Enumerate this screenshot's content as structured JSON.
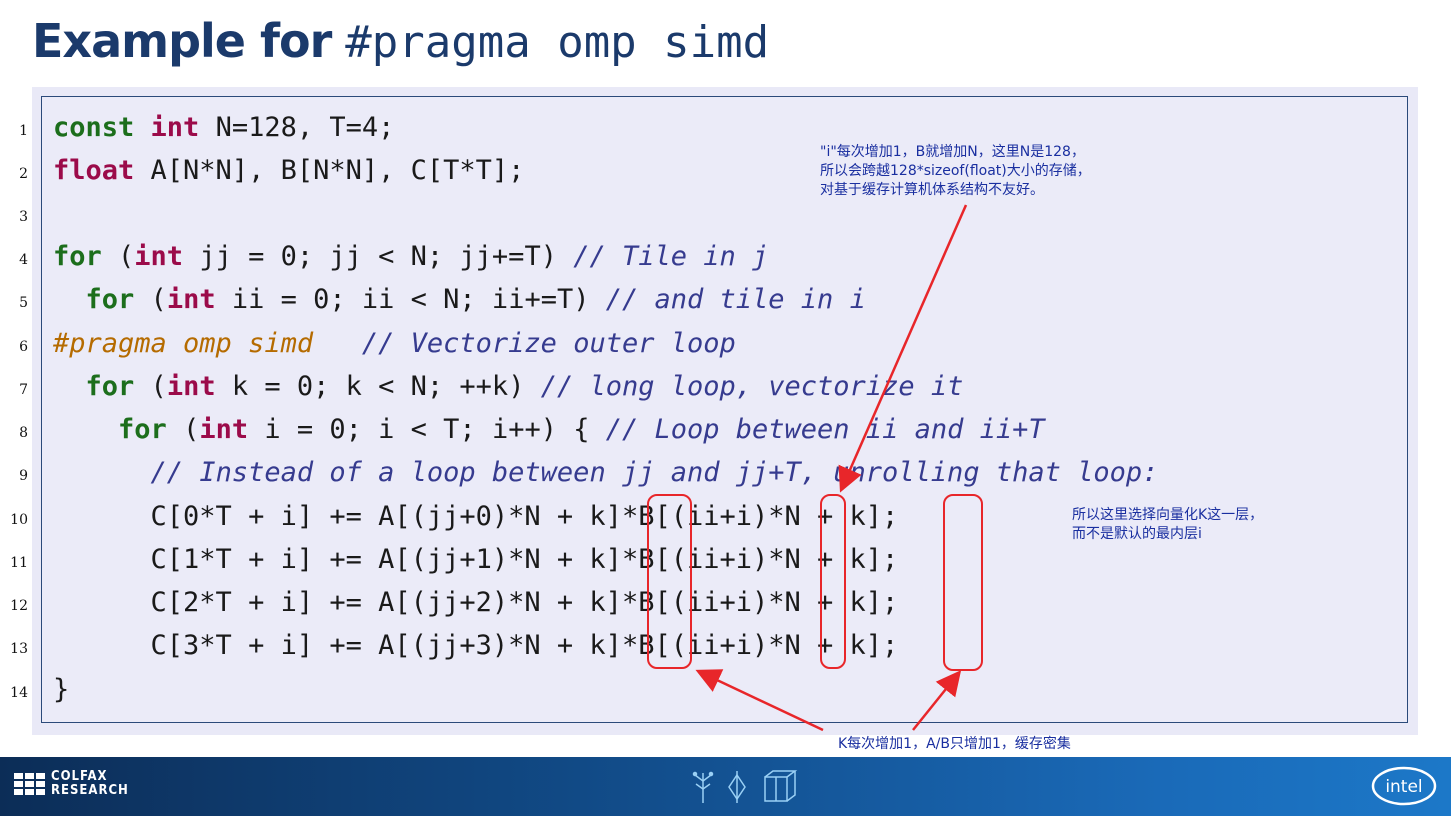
{
  "title": {
    "main": "Example for",
    "code": "#pragma omp simd"
  },
  "line_numbers": [
    "1",
    "2",
    "3",
    "4",
    "5",
    "6",
    "7",
    "8",
    "9",
    "10",
    "11",
    "12",
    "13",
    "14"
  ],
  "code": {
    "l1": {
      "kw_const": "const",
      "kw_int": "int",
      "rest": " N=128, T=4;"
    },
    "l2": {
      "kw_float": "float",
      "rest": " A[N*N], B[N*N], C[T*T];"
    },
    "l4": {
      "kw_for": "for",
      "p1": " (",
      "kw_int": "int",
      "p2": " jj = 0; jj < N; jj+=T) ",
      "comment": "// Tile in j"
    },
    "l5": {
      "indent": "  ",
      "kw_for": "for",
      "p1": " (",
      "kw_int": "int",
      "p2": " ii = 0; ii < N; ii+=T) ",
      "comment": "// and tile in i"
    },
    "l6": {
      "pragma": "#pragma omp simd",
      "gap": "   ",
      "comment": "// Vectorize outer loop"
    },
    "l7": {
      "indent": "  ",
      "kw_for": "for",
      "p1": " (",
      "kw_int": "int",
      "p2": " k = 0; k < N; ++k) ",
      "comment": "// long loop, vectorize it"
    },
    "l8": {
      "indent": "    ",
      "kw_for": "for",
      "p1": " (",
      "kw_int": "int",
      "p2": " i = 0; i < T; i++) { ",
      "comment": "// Loop between ii and ii+T"
    },
    "l9": {
      "indent": "      ",
      "comment": "// Instead of a loop between jj and jj+T, unrolling that loop:"
    },
    "l10": "      C[0*T + i] += A[(jj+0)*N + k]*B[(ii+i)*N + k];",
    "l11": "      C[1*T + i] += A[(jj+1)*N + k]*B[(ii+i)*N + k];",
    "l12": "      C[2*T + i] += A[(jj+2)*N + k]*B[(ii+i)*N + k];",
    "l13": "      C[3*T + i] += A[(jj+3)*N + k]*B[(ii+i)*N + k];",
    "l14": "}"
  },
  "annotations": {
    "top_note": [
      "\"i\"每次增加1，B就增加N，这里N是128，",
      "所以会跨越128*sizeof(float)大小的存储，",
      "对基于缓存计算机体系结构不友好。"
    ],
    "right_note": [
      "所以这里选择向量化K这一层，",
      "而不是默认的最内层i"
    ],
    "bottom_note": "K每次增加1，A/B只增加1，缓存密集"
  },
  "footer": {
    "brand_line1": "COLFAX",
    "brand_line2": "RESEARCH",
    "intel_label": "intel"
  },
  "colors": {
    "title": "#1b3a6b",
    "keyword_for": "#1c6e1c",
    "keyword_type": "#9b0b4a",
    "comment": "#363b8f",
    "pragma": "#b56b00",
    "arrow": "#e8262a",
    "note_text": "#1a2fa0"
  }
}
